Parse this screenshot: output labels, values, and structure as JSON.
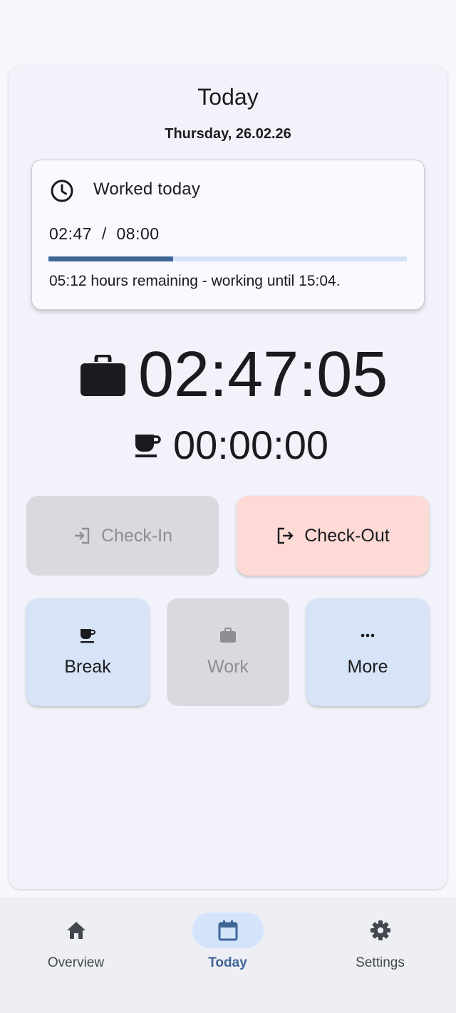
{
  "page": {
    "title": "Today",
    "date": "Thursday, 26.02.26"
  },
  "worked_card": {
    "title": "Worked today",
    "progress_text": "02:47  /  08:00",
    "progress_fraction": 0.347,
    "remaining_text": "05:12 hours remaining - working until 15:04.",
    "icon": "clock-icon"
  },
  "timers": {
    "work": "02:47:05",
    "break": "00:00:00",
    "work_icon": "briefcase-icon",
    "break_icon": "coffee-cup-icon"
  },
  "actions": {
    "check_in": {
      "label": "Check-In",
      "icon": "login-icon",
      "enabled": false
    },
    "check_out": {
      "label": "Check-Out",
      "icon": "logout-icon",
      "enabled": true
    }
  },
  "tiles": {
    "break": {
      "label": "Break",
      "icon": "coffee-cup-icon",
      "enabled": true
    },
    "work": {
      "label": "Work",
      "icon": "briefcase-icon",
      "enabled": false
    },
    "more": {
      "label": "More",
      "icon": "more-horizontal-icon",
      "enabled": true
    }
  },
  "nav": {
    "items": [
      {
        "label": "Overview",
        "icon": "home-icon",
        "active": false
      },
      {
        "label": "Today",
        "icon": "calendar-icon",
        "active": true
      },
      {
        "label": "Settings",
        "icon": "gear-icon",
        "active": false
      }
    ]
  },
  "colors": {
    "accent": "#3f6595",
    "progress_track": "#d6e2f7",
    "checkout_bg": "#fddad6",
    "tile_bg": "#d7e3f7",
    "disabled_bg": "#d9dadf",
    "nav_active_bg": "#d3e3fa"
  }
}
